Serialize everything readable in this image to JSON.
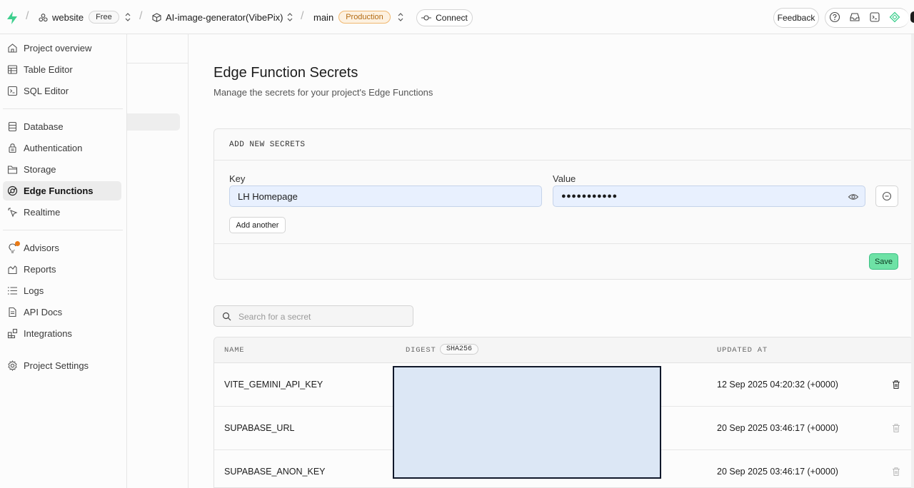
{
  "topbar": {
    "org": "website",
    "plan": "Free",
    "project": "AI-image-generator(VibePix)",
    "branch": "main",
    "env": "Production",
    "connect": "Connect",
    "feedback": "Feedback"
  },
  "sidebar": {
    "items": [
      {
        "label": "Project overview",
        "icon": "home-icon"
      },
      {
        "label": "Table Editor",
        "icon": "table-icon"
      },
      {
        "label": "SQL Editor",
        "icon": "terminal-icon"
      },
      {
        "label": "Database",
        "icon": "database-icon"
      },
      {
        "label": "Authentication",
        "icon": "lock-icon"
      },
      {
        "label": "Storage",
        "icon": "folder-icon"
      },
      {
        "label": "Edge Functions",
        "icon": "edge-functions-icon"
      },
      {
        "label": "Realtime",
        "icon": "cursor-icon"
      },
      {
        "label": "Advisors",
        "icon": "lightbulb-icon"
      },
      {
        "label": "Reports",
        "icon": "chart-icon"
      },
      {
        "label": "Logs",
        "icon": "list-icon"
      },
      {
        "label": "API Docs",
        "icon": "document-icon"
      },
      {
        "label": "Integrations",
        "icon": "blocks-icon"
      },
      {
        "label": "Project Settings",
        "icon": "gear-icon"
      }
    ],
    "active": "Edge Functions",
    "advisor_badge_color": "#e97a16"
  },
  "page": {
    "title": "Edge Function Secrets",
    "subtitle": "Manage the secrets for your project's Edge Functions"
  },
  "add_secrets": {
    "heading": "ADD NEW SECRETS",
    "key_label": "Key",
    "value_label": "Value",
    "key_value": "LH Homepage",
    "value_masked": "●●●●●●●●●●●",
    "add_another": "Add another",
    "save": "Save"
  },
  "search": {
    "placeholder": "Search for a secret"
  },
  "table": {
    "columns": {
      "name": "NAME",
      "digest": "DIGEST",
      "digest_algo": "SHA256",
      "updated": "UPDATED AT"
    },
    "rows": [
      {
        "name": "VITE_GEMINI_API_KEY",
        "updated": "12 Sep 2025 04:20:32 (+0000)"
      },
      {
        "name": "SUPABASE_URL",
        "updated": "20 Sep 2025 03:46:17 (+0000)"
      },
      {
        "name": "SUPABASE_ANON_KEY",
        "updated": "20 Sep 2025 03:46:17 (+0000)"
      }
    ]
  },
  "colors": {
    "accent": "#3ecf8e",
    "save_bg": "#6ee2a6",
    "production_text": "#b36b12",
    "input_bg": "#e8f0fe"
  }
}
